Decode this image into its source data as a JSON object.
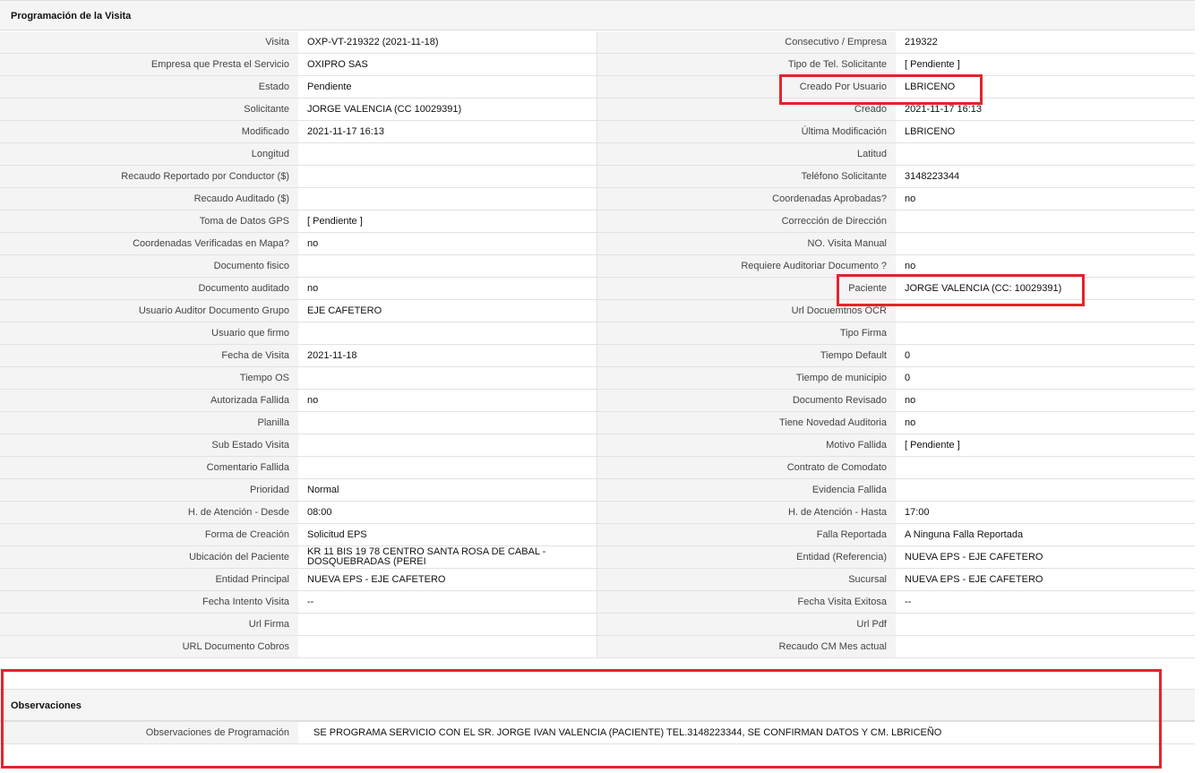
{
  "section1": {
    "title": "Programación de la Visita",
    "rows": [
      {
        "l1": "Visita",
        "v1": "OXP-VT-219322 (2021-11-18)",
        "l2": "Consecutivo / Empresa",
        "v2": "219322"
      },
      {
        "l1": "Empresa que Presta el Servicio",
        "v1": "OXIPRO SAS",
        "l2": "Tipo de Tel. Solicitante",
        "v2": "[ Pendiente ]"
      },
      {
        "l1": "Estado",
        "v1": "Pendiente",
        "l2": "Creado Por Usuario",
        "v2": "LBRICENO"
      },
      {
        "l1": "Solicitante",
        "v1": "JORGE VALENCIA (CC 10029391)",
        "l2": "Creado",
        "v2": "2021-11-17 16:13"
      },
      {
        "l1": "Modificado",
        "v1": "2021-11-17 16:13",
        "l2": "Última Modificación",
        "v2": " LBRICENO"
      },
      {
        "l1": "Longitud",
        "v1": "",
        "l2": "Latitud",
        "v2": ""
      },
      {
        "l1": "Recaudo Reportado por Conductor ($)",
        "v1": "",
        "l2": "Teléfono Solicitante",
        "v2": "3148223344"
      },
      {
        "l1": "Recaudo Auditado ($)",
        "v1": "",
        "l2": "Coordenadas Aprobadas?",
        "v2": " no"
      },
      {
        "l1": "Toma de Datos GPS",
        "v1": "[ Pendiente ]",
        "l2": "Corrección de Dirección",
        "v2": ""
      },
      {
        "l1": "Coordenadas Verificadas en Mapa?",
        "v1": " no",
        "l2": "NO. Visita Manual",
        "v2": ""
      },
      {
        "l1": "Documento fisico",
        "v1": "",
        "l2": "Requiere Auditoriar Documento ?",
        "v2": " no"
      },
      {
        "l1": "Documento auditado",
        "v1": " no",
        "l2": "Paciente",
        "v2": "JORGE VALENCIA (CC: 10029391)"
      },
      {
        "l1": "Usuario Auditor Documento Grupo",
        "v1": "EJE CAFETERO",
        "l2": "Url Docuemtnos OCR",
        "v2": ""
      },
      {
        "l1": "Usuario que firmo",
        "v1": "",
        "l2": "Tipo Firma",
        "v2": ""
      },
      {
        "l1": "Fecha de Visita",
        "v1": " 2021-11-18",
        "l2": "Tiempo Default",
        "v2": "0"
      },
      {
        "l1": "Tiempo OS",
        "v1": "",
        "l2": "Tiempo de municipio",
        "v2": "0"
      },
      {
        "l1": "Autorizada Fallida",
        "v1": " no",
        "l2": "Documento Revisado",
        "v2": " no"
      },
      {
        "l1": "Planilla",
        "v1": "",
        "l2": "Tiene Novedad Auditoria",
        "v2": " no"
      },
      {
        "l1": "Sub Estado Visita",
        "v1": "",
        "l2": "Motivo Fallida",
        "v2": "[ Pendiente ]"
      },
      {
        "l1": "Comentario Fallida",
        "v1": "",
        "l2": "Contrato de Comodato",
        "v2": ""
      },
      {
        "l1": "Prioridad",
        "v1": "Normal",
        "l2": "Evidencia Fallida",
        "v2": ""
      },
      {
        "l1": "H. de Atención - Desde",
        "v1": "08:00",
        "l2": "H. de Atención - Hasta",
        "v2": "17:00"
      },
      {
        "l1": "Forma de Creación",
        "v1": "Solicitud EPS",
        "l2": "Falla Reportada",
        "v2": "A Ninguna Falla Reportada"
      },
      {
        "l1": "Ubicación del Paciente",
        "v1": "KR 11 BIS 19 78 CENTRO SANTA ROSA DE CABAL - DOSQUEBRADAS (PEREI",
        "l2": "Entidad (Referencia)",
        "v2": "NUEVA EPS - EJE CAFETERO"
      },
      {
        "l1": "Entidad Principal",
        "v1": "NUEVA EPS - EJE CAFETERO",
        "l2": "Sucursal",
        "v2": "NUEVA EPS - EJE CAFETERO"
      },
      {
        "l1": "Fecha Intento Visita",
        "v1": " --",
        "l2": "Fecha Visita Exitosa",
        "v2": " --"
      },
      {
        "l1": "Url Firma",
        "v1": "",
        "l2": "Url Pdf",
        "v2": ""
      },
      {
        "l1": "URL Documento Cobros",
        "v1": "",
        "l2": "Recaudo CM Mes actual",
        "v2": ""
      }
    ]
  },
  "section2": {
    "title": "Observaciones",
    "label": "Observaciones de Programación",
    "value": "SE PROGRAMA SERVICIO CON EL SR. JORGE IVAN VALENCIA (PACIENTE) TEL.3148223344, SE CONFIRMAN DATOS Y CM. LBRICEÑO"
  },
  "highlight_color": "#e3242b"
}
